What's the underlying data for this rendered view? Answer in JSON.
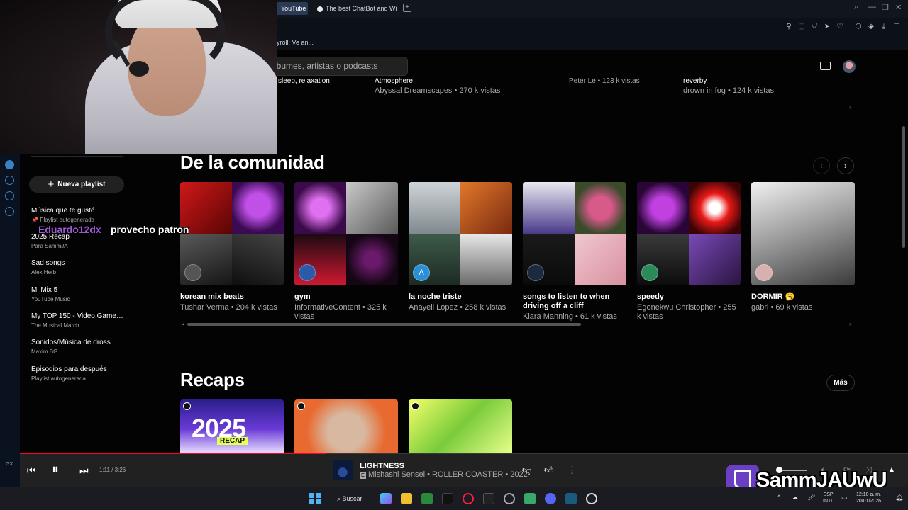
{
  "browser": {
    "tabs": [
      {
        "label": "YouTube",
        "active": true
      },
      {
        "label": "The best ChatBot and Wid",
        "active": false
      }
    ],
    "new_tab": "+",
    "bookmark_text": "yroll: Ve an..."
  },
  "header": {
    "search_placeholder": "lbumes, artistas o podcasts"
  },
  "sidebar": {
    "new_playlist": "Nueva playlist",
    "playlists": [
      {
        "title": "Música que te gustó",
        "subtitle": "Playlist autogenerada",
        "pinned": true
      },
      {
        "title": "2025 Recap",
        "subtitle": "Para SammJA"
      },
      {
        "title": "Sad songs",
        "subtitle": "Alex Herb"
      },
      {
        "title": "Mi Mix 5",
        "subtitle": "YouTube Music"
      },
      {
        "title": "My TOP 150 - Video Game S...",
        "subtitle": "The Musical March"
      },
      {
        "title": "Sonidos/Música de dross",
        "subtitle": "Maxim BG"
      },
      {
        "title": "Episodios para después",
        "subtitle": "Playlist autogenerada"
      }
    ]
  },
  "previous_row": {
    "top_fragments": [
      "sleep, relaxation",
      "Atmosphere",
      "Peter Le • 123 k vistas",
      "reverby"
    ],
    "items": [
      {
        "subtitle": "Abyssal Dreamscapes • 270 k vistas"
      },
      {
        "subtitle": "drown in fog • 124 k vistas"
      }
    ]
  },
  "community": {
    "title": "De la comunidad",
    "cards": [
      {
        "title": "korean mix beats",
        "subtitle": "Tushar Verma • 204 k vistas",
        "badge": ""
      },
      {
        "title": "gym",
        "subtitle": "InformativeContent • 325 k vistas",
        "badge": ""
      },
      {
        "title": "la noche triste",
        "subtitle": "Anayeli Lopez • 258 k vistas",
        "badge": "A"
      },
      {
        "title": "songs to listen to when driving off a cliff",
        "subtitle": "Kiara Manning • 61 k vistas",
        "badge": ""
      },
      {
        "title": "speedy",
        "subtitle": "Egonekwu Christopher • 255 k vistas",
        "badge": ""
      },
      {
        "title": "DORMIR 🥱",
        "subtitle": "gabri • 69 k vistas",
        "badge": ""
      }
    ]
  },
  "recaps": {
    "title": "Recaps",
    "more_label": "Más",
    "cover_text": "2025",
    "cover_tag": "RECAP"
  },
  "overlay": {
    "chat_user": "Eduardo12dx",
    "chat_message": "provecho patron",
    "streamer": "SammJAUwU"
  },
  "player": {
    "time": "1:11 / 3:26",
    "progress_fraction": 0.345,
    "track_title": "LIGHTNESS",
    "track_meta": "Mishashi Sensei • ROLLER COASTER • 2022",
    "explicit_badge": "E"
  },
  "taskbar": {
    "search_label": "Buscar",
    "lang_top": "ESP",
    "lang_bottom": "INTL",
    "time": "12:10 a. m.",
    "date": "20/01/2026"
  },
  "colors": {
    "accent_red": "#ff0033",
    "twitch_purple": "#6a3fc4",
    "chat_name": "#9b59d6"
  }
}
